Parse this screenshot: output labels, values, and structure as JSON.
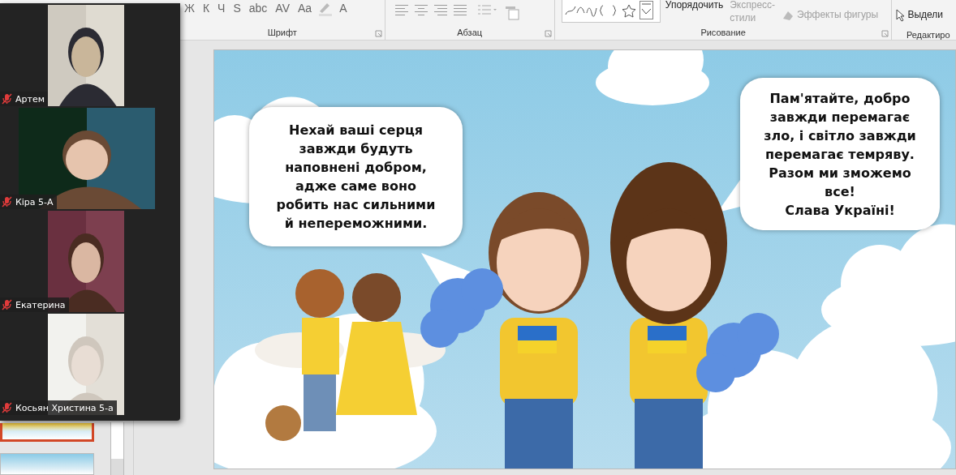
{
  "ribbon": {
    "font_group": {
      "buttons": [
        "Ж",
        "К",
        "Ч",
        "S",
        "abc",
        "AV",
        "Aa",
        "A"
      ],
      "label": "Шрифт"
    },
    "paragraph_group": {
      "label": "Абзац"
    },
    "drawing_group": {
      "arrange": "Упорядочить",
      "quick_styles": "Экспресс-\nстили",
      "shape_effects": "Эффекты фигуры",
      "label": "Рисование"
    },
    "editing_group": {
      "select": "Выдели",
      "label": "Редактиро"
    }
  },
  "video_call": {
    "participants": [
      {
        "name": "Артем",
        "muted": true
      },
      {
        "name": "Кіра 5-А",
        "muted": true
      },
      {
        "name": "Екатерина",
        "muted": true
      },
      {
        "name": "Косьян Христина 5-а",
        "muted": true
      }
    ]
  },
  "slides_pane": {
    "thumbnails": [
      {
        "selected": true
      },
      {
        "selected": false
      }
    ]
  },
  "slide": {
    "bubbles": [
      {
        "text": "Нехай ваші серця\nзавжди будуть\nнаповнені добром,\nадже саме воно\nробить нас сильними\nй непереможними."
      },
      {
        "text": "Пам'ятайте, добро\nзавжди перемагає\nзло, і світло завжди\nперемагає темряву.\nРазом ми зможемо\nвсе!\nСлава Україні!"
      }
    ]
  }
}
